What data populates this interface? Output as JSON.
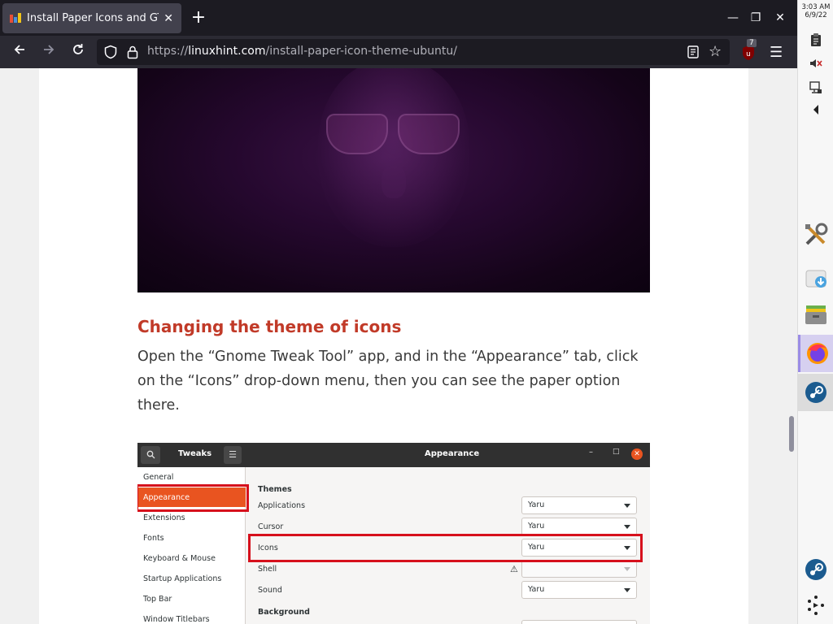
{
  "browser": {
    "tab_title": "Install Paper Icons and GTK",
    "tab_close": "✕",
    "new_tab": "+",
    "window_controls": {
      "minimize": "—",
      "restore": "❐",
      "close": "✕"
    },
    "url_scheme": "https://",
    "url_domain": "linuxhint.com",
    "url_path": "/install-paper-icon-theme-ubuntu/",
    "ublock_count": "7"
  },
  "article": {
    "section_title": "Changing the theme of icons",
    "paragraph": "Open the “Gnome Tweak Tool” app, and in the “Appearance” tab, click on the “Icons” drop-down menu, then you can see the paper option there."
  },
  "tweaks": {
    "header_left": "Tweaks",
    "header_center": "Appearance",
    "sidebar": [
      "General",
      "Appearance",
      "Extensions",
      "Fonts",
      "Keyboard & Mouse",
      "Startup Applications",
      "Top Bar",
      "Window Titlebars"
    ],
    "themes_heading": "Themes",
    "rows": [
      {
        "label": "Applications",
        "value": "Yaru"
      },
      {
        "label": "Cursor",
        "value": "Yaru"
      },
      {
        "label": "Icons",
        "value": "Yaru"
      },
      {
        "label": "Shell",
        "value": ""
      },
      {
        "label": "Sound",
        "value": "Yaru"
      }
    ],
    "background_heading": "Background"
  },
  "taskbar": {
    "time": "3:03 AM",
    "date": "6/9/22",
    "apps": [
      "system-settings-icon",
      "downloads-icon",
      "archive-manager-icon",
      "firefox-icon",
      "steam-icon"
    ]
  },
  "colors": {
    "accent_heading": "#c13a28",
    "ubuntu_orange": "#e95420",
    "highlight_red": "#d6101c"
  }
}
